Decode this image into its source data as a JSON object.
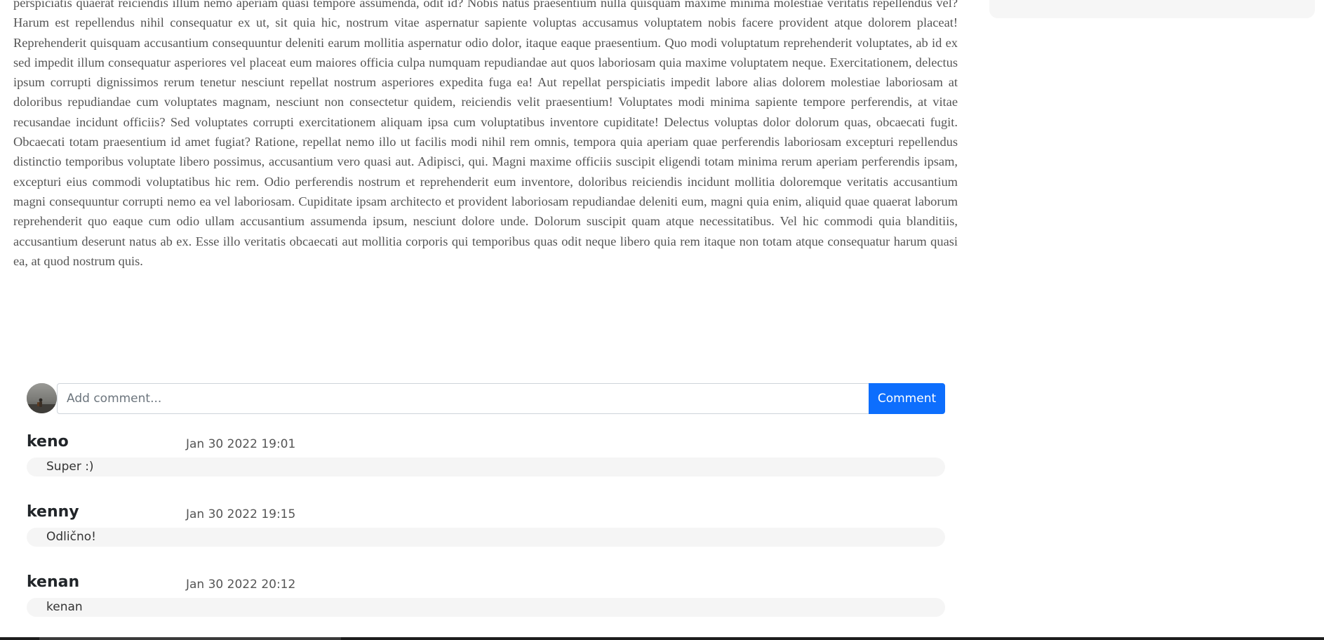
{
  "article": {
    "text": "perspiciatis quaerat reiciendis illum nemo aperiam quasi tempore assumenda, odit id? Nobis natus praesentium nulla quisquam maxime minima molestiae veritatis repellendus vel? Harum est repellendus nihil consequatur ex ut, sit quia hic, nostrum vitae aspernatur sapiente voluptas accusamus voluptatem nobis facere provident atque dolorem placeat! Reprehenderit quisquam accusantium consequuntur deleniti earum mollitia aspernatur odio dolor, itaque eaque praesentium. Quo modi voluptatum reprehenderit voluptates, ab id ex sed impedit illum consequatur asperiores vel placeat eum maiores officia culpa numquam repudiandae aut quos laboriosam quia maxime voluptatem neque. Exercitationem, delectus ipsum corrupti dignissimos rerum tenetur nesciunt repellat nostrum asperiores expedita fuga ea! Aut repellat perspiciatis impedit labore alias dolorem molestiae laboriosam at doloribus repudiandae cum voluptates magnam, nesciunt non consectetur quidem, reiciendis velit praesentium! Voluptates modi minima sapiente tempore perferendis, at vitae recusandae incidunt officiis? Sed voluptates corrupti exercitationem aliquam ipsa cum voluptatibus inventore cupiditate! Delectus voluptas dolor dolorum quas, obcaecati fugit. Obcaecati totam praesentium id amet fugiat? Ratione, repellat nemo illo ut facilis modi nihil rem omnis, tempora quia aperiam quae perferendis laboriosam excepturi repellendus distinctio temporibus voluptate libero possimus, accusantium vero quasi aut. Adipisci, qui. Magni maxime officiis suscipit eligendi totam minima rerum aperiam perferendis ipsam, excepturi eius commodi voluptatibus hic rem. Odio perferendis nostrum et reprehenderit eum inventore, doloribus reiciendis incidunt mollitia doloremque veritatis accusantium magni consequuntur corrupti nemo ea vel laboriosam. Cupiditate ipsam architecto et provident laboriosam repudiandae deleniti eum, magni quia enim, aliquid quae quaerat laborum reprehenderit quo eaque cum odio ullam accusantium assumenda ipsum, nesciunt dolore unde. Dolorum suscipit quam atque necessitatibus. Vel hic commodi quia blanditiis, accusantium deserunt natus ab ex. Esse illo veritatis obcaecati aut mollitia corporis qui temporibus quas odit neque libero quia rem itaque non totam atque consequatur harum quasi ea, at quod nostrum quis."
  },
  "comment_form": {
    "placeholder": "Add comment...",
    "value": "",
    "button_label": "Comment",
    "avatar_icon": "user-avatar-photo"
  },
  "comments": [
    {
      "author": "keno",
      "time": "Jan 30 2022 19:01",
      "text": "Super :)"
    },
    {
      "author": "kenny",
      "time": "Jan 30 2022 19:15",
      "text": "Odlično!"
    },
    {
      "author": "kenan",
      "time": "Jan 30 2022 20:12",
      "text": "kenan"
    }
  ],
  "colors": {
    "accent": "#0d6efd",
    "article_text": "#555555",
    "bubble_bg": "#f5f5f5"
  }
}
